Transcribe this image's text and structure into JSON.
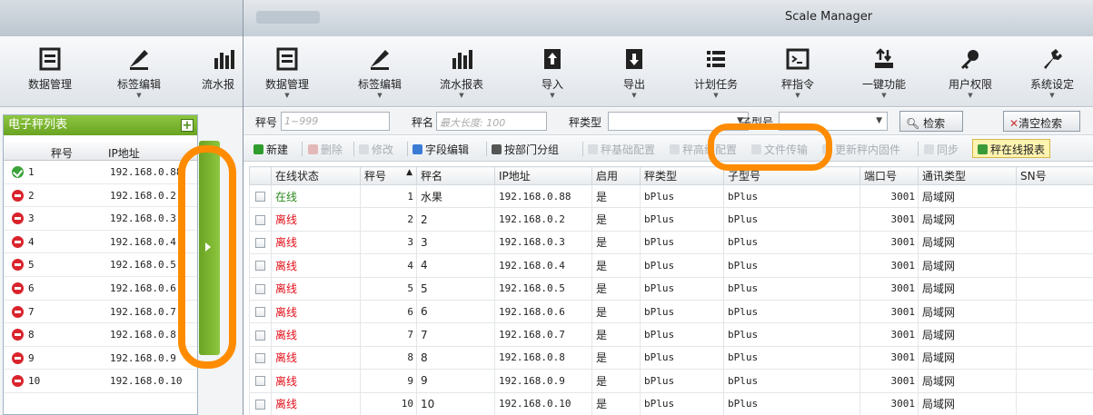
{
  "colors": {
    "accent_green": "#6aa323",
    "highlight_orange": "#ff8c00",
    "online": "#2a8a1f",
    "offline": "#e0101a"
  },
  "bg_window": {
    "ribbon": [
      {
        "label": "数据管理",
        "icon": "data-management-icon"
      },
      {
        "label": "标签编辑",
        "icon": "label-edit-icon"
      },
      {
        "label": "流水报",
        "icon": "flow-report-icon"
      }
    ],
    "panel_title": "电子秤列表",
    "columns": [
      "秤号",
      "IP地址"
    ],
    "rows": [
      {
        "no": "1",
        "ip": "192.168.0.88",
        "status": "online"
      },
      {
        "no": "2",
        "ip": "192.168.0.2",
        "status": "offline"
      },
      {
        "no": "3",
        "ip": "192.168.0.3",
        "status": "offline"
      },
      {
        "no": "4",
        "ip": "192.168.0.4",
        "status": "offline"
      },
      {
        "no": "5",
        "ip": "192.168.0.5",
        "status": "offline"
      },
      {
        "no": "6",
        "ip": "192.168.0.6",
        "status": "offline"
      },
      {
        "no": "7",
        "ip": "192.168.0.7",
        "status": "offline"
      },
      {
        "no": "8",
        "ip": "192.168.0.8",
        "status": "offline"
      },
      {
        "no": "9",
        "ip": "192.168.0.9",
        "status": "offline"
      },
      {
        "no": "10",
        "ip": "192.168.0.10",
        "status": "offline"
      }
    ]
  },
  "fg_window": {
    "title": "Scale Manager",
    "ribbon": [
      {
        "label": "数据管理",
        "icon": "data-management-icon"
      },
      {
        "label": "标签编辑",
        "icon": "label-edit-icon"
      },
      {
        "label": "流水报表",
        "icon": "flow-report-icon"
      },
      {
        "label": "导入",
        "icon": "import-icon"
      },
      {
        "label": "导出",
        "icon": "export-icon"
      },
      {
        "label": "计划任务",
        "icon": "schedule-icon"
      },
      {
        "label": "秤指令",
        "icon": "scale-command-icon"
      },
      {
        "label": "一键功能",
        "icon": "one-key-icon"
      },
      {
        "label": "用户权限",
        "icon": "user-permission-icon"
      },
      {
        "label": "系统设定",
        "icon": "system-settings-icon"
      }
    ],
    "search": {
      "scale_no_label": "秤号",
      "scale_no_placeholder": "1~999",
      "scale_name_label": "秤名",
      "scale_name_placeholder": "最大长度: 100",
      "scale_type_label": "秤类型",
      "sub_type_label": "子型号",
      "search_button": "检索",
      "clear_button": "清空检索"
    },
    "toolbar": {
      "new": "新建",
      "delete": "删除",
      "modify": "修改",
      "field_edit": "字段编辑",
      "group_by_dept": "按部门分组",
      "basic_config": "秤基础配置",
      "advanced_config": "秤高级配置",
      "file_transfer": "文件传输",
      "update_firmware": "更新秤内固件",
      "sync": "同步",
      "online_report": "秤在线报表"
    },
    "grid": {
      "columns": [
        "在线状态",
        "秤号",
        "秤名",
        "IP地址",
        "启用",
        "秤类型",
        "子型号",
        "端口号",
        "通讯类型",
        "SN号"
      ],
      "sort_indicator": "▲",
      "rows": [
        {
          "status": "在线",
          "no": "1",
          "name": "水果",
          "ip": "192.168.0.88",
          "enabled": "是",
          "type": "bPlus",
          "subtype": "bPlus",
          "port": "3001",
          "comm": "局域网",
          "sn": "",
          "online": true
        },
        {
          "status": "离线",
          "no": "2",
          "name": "2",
          "ip": "192.168.0.2",
          "enabled": "是",
          "type": "bPlus",
          "subtype": "bPlus",
          "port": "3001",
          "comm": "局域网",
          "sn": "",
          "online": false
        },
        {
          "status": "离线",
          "no": "3",
          "name": "3",
          "ip": "192.168.0.3",
          "enabled": "是",
          "type": "bPlus",
          "subtype": "bPlus",
          "port": "3001",
          "comm": "局域网",
          "sn": "",
          "online": false
        },
        {
          "status": "离线",
          "no": "4",
          "name": "4",
          "ip": "192.168.0.4",
          "enabled": "是",
          "type": "bPlus",
          "subtype": "bPlus",
          "port": "3001",
          "comm": "局域网",
          "sn": "",
          "online": false
        },
        {
          "status": "离线",
          "no": "5",
          "name": "5",
          "ip": "192.168.0.5",
          "enabled": "是",
          "type": "bPlus",
          "subtype": "bPlus",
          "port": "3001",
          "comm": "局域网",
          "sn": "",
          "online": false
        },
        {
          "status": "离线",
          "no": "6",
          "name": "6",
          "ip": "192.168.0.6",
          "enabled": "是",
          "type": "bPlus",
          "subtype": "bPlus",
          "port": "3001",
          "comm": "局域网",
          "sn": "",
          "online": false
        },
        {
          "status": "离线",
          "no": "7",
          "name": "7",
          "ip": "192.168.0.7",
          "enabled": "是",
          "type": "bPlus",
          "subtype": "bPlus",
          "port": "3001",
          "comm": "局域网",
          "sn": "",
          "online": false
        },
        {
          "status": "离线",
          "no": "8",
          "name": "8",
          "ip": "192.168.0.8",
          "enabled": "是",
          "type": "bPlus",
          "subtype": "bPlus",
          "port": "3001",
          "comm": "局域网",
          "sn": "",
          "online": false
        },
        {
          "status": "离线",
          "no": "9",
          "name": "9",
          "ip": "192.168.0.9",
          "enabled": "是",
          "type": "bPlus",
          "subtype": "bPlus",
          "port": "3001",
          "comm": "局域网",
          "sn": "",
          "online": false
        },
        {
          "status": "离线",
          "no": "10",
          "name": "10",
          "ip": "192.168.0.10",
          "enabled": "是",
          "type": "bPlus",
          "subtype": "bPlus",
          "port": "3001",
          "comm": "局域网",
          "sn": "",
          "online": false
        }
      ]
    }
  }
}
